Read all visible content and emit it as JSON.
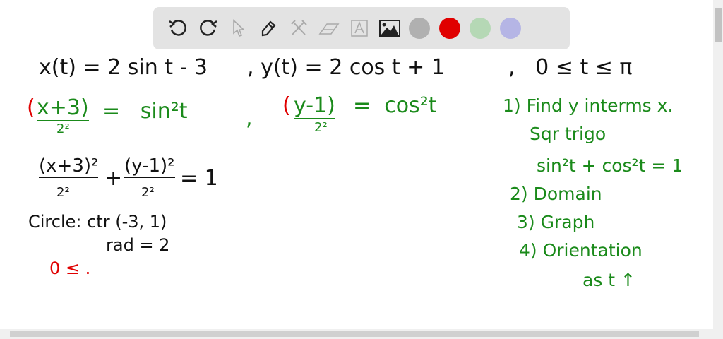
{
  "toolbar": {
    "tools": [
      "undo-icon",
      "redo-icon",
      "select-icon",
      "pen-icon",
      "tools-icon",
      "eraser-icon",
      "text-icon",
      "image-icon"
    ],
    "colors": {
      "gray": "#b0b0b0",
      "red": "#e00000",
      "green": "#b5d8b5",
      "purple": "#b5b5e5"
    }
  },
  "board": {
    "line1": {
      "x": "x(t) = 2 sin t - 3",
      "y": ", y(t) = 2 cos t + 1",
      "t": ",   0 ≤ t ≤ π"
    },
    "line2": {
      "lp1": "(",
      "x": "x+3)",
      "xden": "2²",
      "eq1": "=   sin²t",
      "comma": ",",
      "lp2": "(",
      "y": "y-1)",
      "yden": "2²",
      "eq2": "=  cos²t"
    },
    "eq3": {
      "num1": "(x+3)²",
      "den1": "2²",
      "plus": "+",
      "num2": "(y-1)²",
      "den2": "2²",
      "rhs": "= 1"
    },
    "circle": "Circle: ctr (-3, 1)",
    "rad": "rad = 2",
    "domain_start": "0 ≤ .",
    "steps": [
      "1) Find y interms x.",
      "Sqr trigo",
      "sin²t + cos²t = 1",
      "2) Domain",
      "3) Graph",
      "4) Orientation",
      "as t ↑"
    ]
  }
}
